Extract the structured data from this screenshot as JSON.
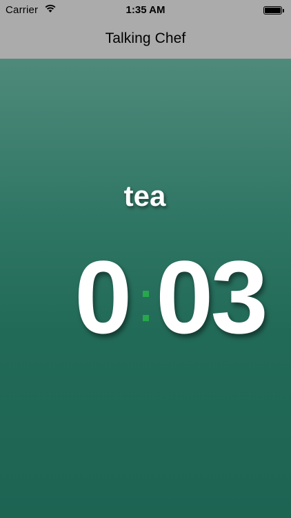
{
  "status_bar": {
    "carrier": "Carrier",
    "time": "1:35 AM",
    "wifi_icon": "wifi-icon",
    "battery_icon": "battery-icon",
    "battery_level": 1.0
  },
  "nav_bar": {
    "title": "Talking Chef"
  },
  "timer": {
    "label": "tea",
    "minutes": "0",
    "seconds": "03",
    "separator_icon": "colon-dots",
    "separator_color": "#27a84a",
    "background_color": "#1e6453"
  }
}
